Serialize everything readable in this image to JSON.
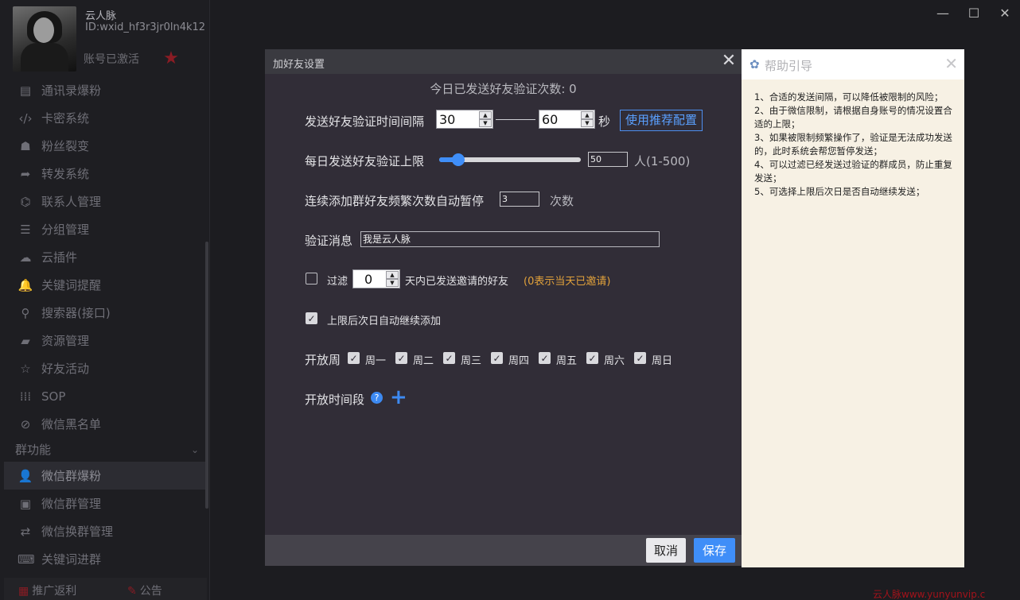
{
  "profile": {
    "nickname": "云人脉",
    "wxid": "ID:wxid_hf3r3jr0ln4k12",
    "status": "账号已激活",
    "vip_icon": "star-vip-icon"
  },
  "sidebar": {
    "items": [
      {
        "label": "通讯录爆粉",
        "icon": "contacts-icon",
        "glyph": "▤"
      },
      {
        "label": "卡密系统",
        "icon": "code-icon",
        "glyph": "‹/›"
      },
      {
        "label": "粉丝裂变",
        "icon": "users-icon",
        "glyph": "☗"
      },
      {
        "label": "转发系统",
        "icon": "share-icon",
        "glyph": "➦"
      },
      {
        "label": "联系人管理",
        "icon": "org-icon",
        "glyph": "⌬"
      },
      {
        "label": "分组管理",
        "icon": "list-icon",
        "glyph": "☰"
      },
      {
        "label": "云插件",
        "icon": "cloud-icon",
        "glyph": "☁"
      },
      {
        "label": "关键词提醒",
        "icon": "bell-icon",
        "glyph": "🔔"
      },
      {
        "label": "搜索器(接口)",
        "icon": "search-icon",
        "glyph": "⚲"
      },
      {
        "label": "资源管理",
        "icon": "folder-icon",
        "glyph": "▰"
      },
      {
        "label": "好友活动",
        "icon": "star-icon",
        "glyph": "☆"
      },
      {
        "label": "SOP",
        "icon": "grid-icon",
        "glyph": "⁞⁞⁞"
      },
      {
        "label": "微信黑名单",
        "icon": "ban-icon",
        "glyph": "⊘"
      }
    ],
    "group_header": "群功能",
    "group_items": [
      {
        "label": "微信群爆粉",
        "icon": "user-plus-icon",
        "glyph": "👤"
      },
      {
        "label": "微信群管理",
        "icon": "briefcase-icon",
        "glyph": "▣"
      },
      {
        "label": "微信换群管理",
        "icon": "swap-icon",
        "glyph": "⇄"
      },
      {
        "label": "关键词进群",
        "icon": "keyword-icon",
        "glyph": "⌨"
      }
    ],
    "bottom": {
      "promo": "推广返利",
      "notice": "公告"
    }
  },
  "dialog": {
    "title": "加好友设置",
    "today_sent": "今日已发送好友验证次数: 0",
    "interval_label": "发送好友验证时间间隔",
    "interval_min": "30",
    "interval_max": "60",
    "interval_unit": "秒",
    "recommend_button": "使用推荐配置",
    "daily_limit_label": "每日发送好友验证上限",
    "daily_limit_value": "50",
    "daily_limit_range": "人(1-500)",
    "daily_limit_fraction": 0.1,
    "pause_label": "连续添加群好友频繁次数自动暂停",
    "pause_value": "3",
    "pause_unit": "次数",
    "message_label": "验证消息",
    "message_value": "我是云人脉",
    "filter_label": "过滤",
    "filter_days": "0",
    "filter_suffix": "天内已发送邀请的好友",
    "filter_hint": "(0表示当天已邀请)",
    "continue_label": "上限后次日自动继续添加",
    "week_label": "开放周",
    "days": [
      "周一",
      "周二",
      "周三",
      "周四",
      "周五",
      "周六",
      "周日"
    ],
    "timeslot_label": "开放时间段",
    "cancel": "取消",
    "save": "保存"
  },
  "help": {
    "title": "帮助引导",
    "items": [
      "1、合适的发送间隔，可以降低被限制的风险；",
      "2、由于微信限制，请根据自身账号的情况设置合适的上限；",
      "3、如果被限制频繁操作了，验证是无法成功发送的，此时系统会帮您暂停发送；",
      "4、可以过滤已经发送过验证的群成员，防止重复发送；",
      "5、可选择上限后次日是否自动继续发送；"
    ]
  },
  "watermark": "云人脉www.yunyunvip.c",
  "colors": {
    "accent": "#3f8ef8",
    "hint": "#e2a23b",
    "help_bg": "#f7f1e4",
    "dialog_bg": "#312d37"
  }
}
